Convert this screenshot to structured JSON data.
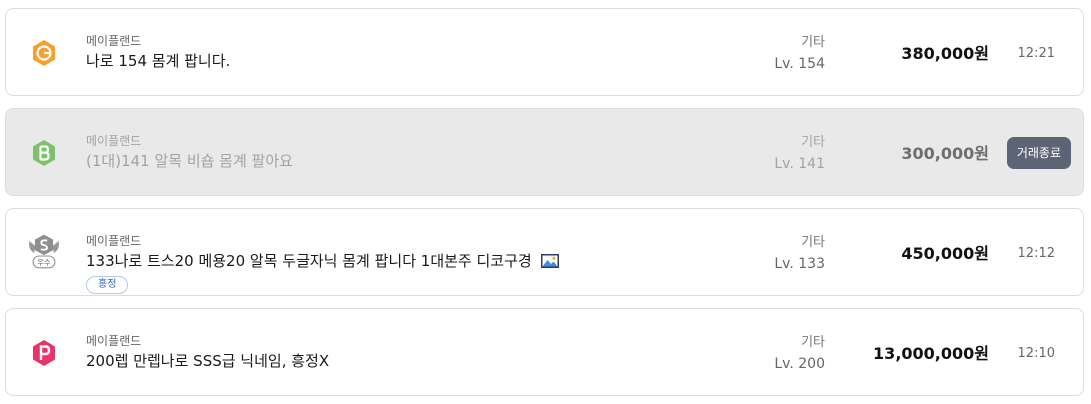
{
  "listings": [
    {
      "badge_icon": "hexagon-g-icon",
      "badge_color": "#f6a02d",
      "badge_letter": "G",
      "server": "메이플랜드",
      "title": "나로 154 몸계 팝니다.",
      "category": "기타",
      "level": "Lv. 154",
      "price": "380,000원",
      "time": "12:21"
    },
    {
      "badge_icon": "hexagon-b-icon",
      "badge_color": "#7cc26d",
      "badge_letter": "B",
      "server": "메이플랜드",
      "title": "(1대)141 알목 비숍 몸계 팔아요",
      "category": "기타",
      "level": "Lv. 141",
      "price": "300,000원",
      "status": "거래종료"
    },
    {
      "badge_icon": "silver-wing-s-icon",
      "badge_color": "#8f8f8f",
      "badge_letter": "S",
      "badge_caption": "우수",
      "server": "메이플랜드",
      "title": "133나로 트스20 메용20 알목 두글자닉 몸계 팝니다 1대본주 디코구경",
      "has_image": true,
      "tag": "흥정",
      "category": "기타",
      "level": "Lv. 133",
      "price": "450,000원",
      "time": "12:12"
    },
    {
      "badge_icon": "hexagon-p-icon",
      "badge_color": "#e8346a",
      "badge_letter": "P",
      "server": "메이플랜드",
      "title": "200렙 만렙나로 SSS급 닉네임, 흥정X",
      "category": "기타",
      "level": "Lv. 200",
      "price": "13,000,000원",
      "time": "12:10"
    }
  ]
}
